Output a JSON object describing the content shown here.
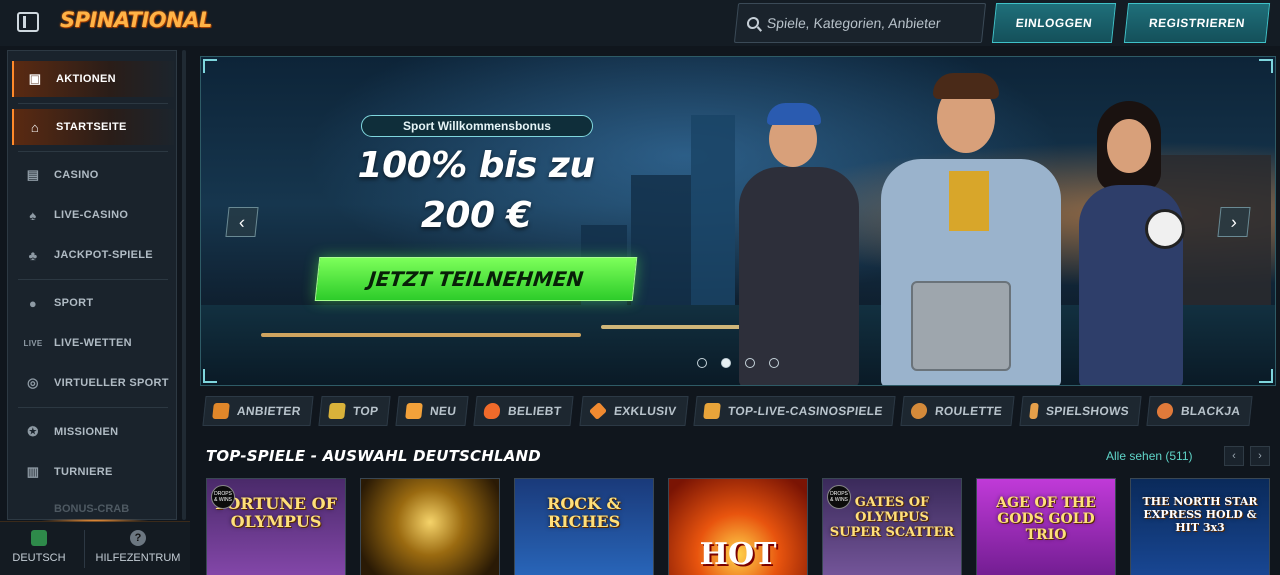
{
  "brand": {
    "logo_text": "SPINATIONAL"
  },
  "header": {
    "search_placeholder": "Spiele, Kategorien, Anbieter",
    "login_label": "EINLOGGEN",
    "register_label": "REGISTRIEREN"
  },
  "sidebar": {
    "items": [
      {
        "label": "AKTIONEN",
        "icon": "gift-icon",
        "active": true
      },
      {
        "label": "STARTSEITE",
        "icon": "home-icon",
        "active": true
      },
      {
        "label": "CASINO",
        "icon": "slot-machine-icon"
      },
      {
        "label": "LIVE-CASINO",
        "icon": "cards-icon"
      },
      {
        "label": "JACKPOT-SPIELE",
        "icon": "clover-icon"
      },
      {
        "label": "SPORT",
        "icon": "soccer-ball-icon"
      },
      {
        "label": "LIVE-WETTEN",
        "icon": "live-icon"
      },
      {
        "label": "VIRTUELLER SPORT",
        "icon": "virtual-ball-icon"
      },
      {
        "label": "MISSIONEN",
        "icon": "mission-icon"
      },
      {
        "label": "TURNIERE",
        "icon": "podium-icon"
      }
    ],
    "faded_item": "BONUS-CRAB",
    "footer": {
      "language": "DEUTSCH",
      "help": "HILFEZENTRUM",
      "help_glyph": "?"
    }
  },
  "banner": {
    "badge": "Sport Willkommensbonus",
    "headline_line1": "100% bis zu",
    "headline_line2": "200 €",
    "cta_label": "JETZT TEILNEHMEN",
    "arrow_left": "‹",
    "arrow_right": "›",
    "slides_count": 4,
    "active_slide": 2
  },
  "categories": [
    {
      "label": "ANBIETER",
      "icon": "provider-icon",
      "color": "#e0872a"
    },
    {
      "label": "TOP",
      "icon": "trophy-icon",
      "color": "#d9b23a"
    },
    {
      "label": "NEU",
      "icon": "lightning-icon",
      "color": "#f2a13a"
    },
    {
      "label": "BELIEBT",
      "icon": "fire-icon",
      "color": "#f06a2a"
    },
    {
      "label": "EXKLUSIV",
      "icon": "diamond-icon",
      "color": "#f08a30"
    },
    {
      "label": "TOP-LIVE-CASINOSPIELE",
      "icon": "star-icon",
      "color": "#e8a43a"
    },
    {
      "label": "ROULETTE",
      "icon": "roulette-icon",
      "color": "#d48a3a"
    },
    {
      "label": "SPIELSHOWS",
      "icon": "microphone-icon",
      "color": "#e6a04a"
    },
    {
      "label": "BLACKJA",
      "icon": "blackjack-icon",
      "color": "#e07a3a"
    }
  ],
  "top_games": {
    "title": "TOP-SPIELE - AUSWAHL DEUTSCHLAND",
    "see_all": "Alle sehen (511)",
    "prev": "‹",
    "next": "›",
    "tiles": [
      {
        "title": "FORTUNE OF OLYMPUS",
        "tag": "DROPS & WINS",
        "bg": "#6a3a8a"
      },
      {
        "title": "",
        "bg": "#6a4a10"
      },
      {
        "title": "ROCK & RICHES",
        "bg": "#1f4f9a"
      },
      {
        "title": "HOT",
        "bg": "#b8320e"
      },
      {
        "title": "GATES OF OLYMPUS SUPER SCATTER",
        "tag": "DROPS & WINS",
        "bg": "#5a3a7a"
      },
      {
        "title": "AGE OF THE GODS GOLD TRIO",
        "bg": "#8a2aa8"
      },
      {
        "title": "THE NORTH STAR EXPRESS HOLD & HIT 3x3",
        "bg": "#103a7a"
      }
    ]
  }
}
